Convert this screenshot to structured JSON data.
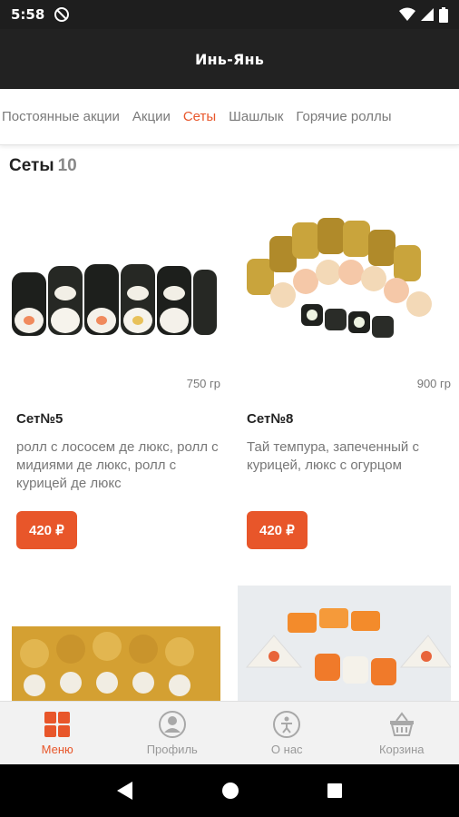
{
  "status_bar": {
    "time": "5:58"
  },
  "app_bar": {
    "title": "Инь-Янь"
  },
  "tabs": [
    {
      "label": "Постоянные акции",
      "active": false
    },
    {
      "label": "Акции",
      "active": false
    },
    {
      "label": "Сеты",
      "active": true
    },
    {
      "label": "Шашлык",
      "active": false
    },
    {
      "label": "Горячие роллы",
      "active": false
    }
  ],
  "section": {
    "title": "Сеты",
    "count": "10"
  },
  "products": [
    {
      "name": "Сет№5",
      "weight": "750 гр",
      "description": "ролл с лососем де люкс, ролл с мидиями де люкс, ролл с курицей де люкс",
      "price": "420 ₽"
    },
    {
      "name": "Сет№8",
      "weight": "900 гр",
      "description": "Тай темпура, запеченный с курицей, люкс с огурцом",
      "price": "420 ₽"
    }
  ],
  "bottom_nav": [
    {
      "label": "Меню",
      "icon": "grid-icon",
      "active": true
    },
    {
      "label": "Профиль",
      "icon": "profile-icon",
      "active": false
    },
    {
      "label": "О нас",
      "icon": "info-icon",
      "active": false
    },
    {
      "label": "Корзина",
      "icon": "basket-icon",
      "active": false
    }
  ],
  "colors": {
    "accent": "#e8562a",
    "app_bar": "#222222",
    "status_bar": "#1e1e1e"
  }
}
